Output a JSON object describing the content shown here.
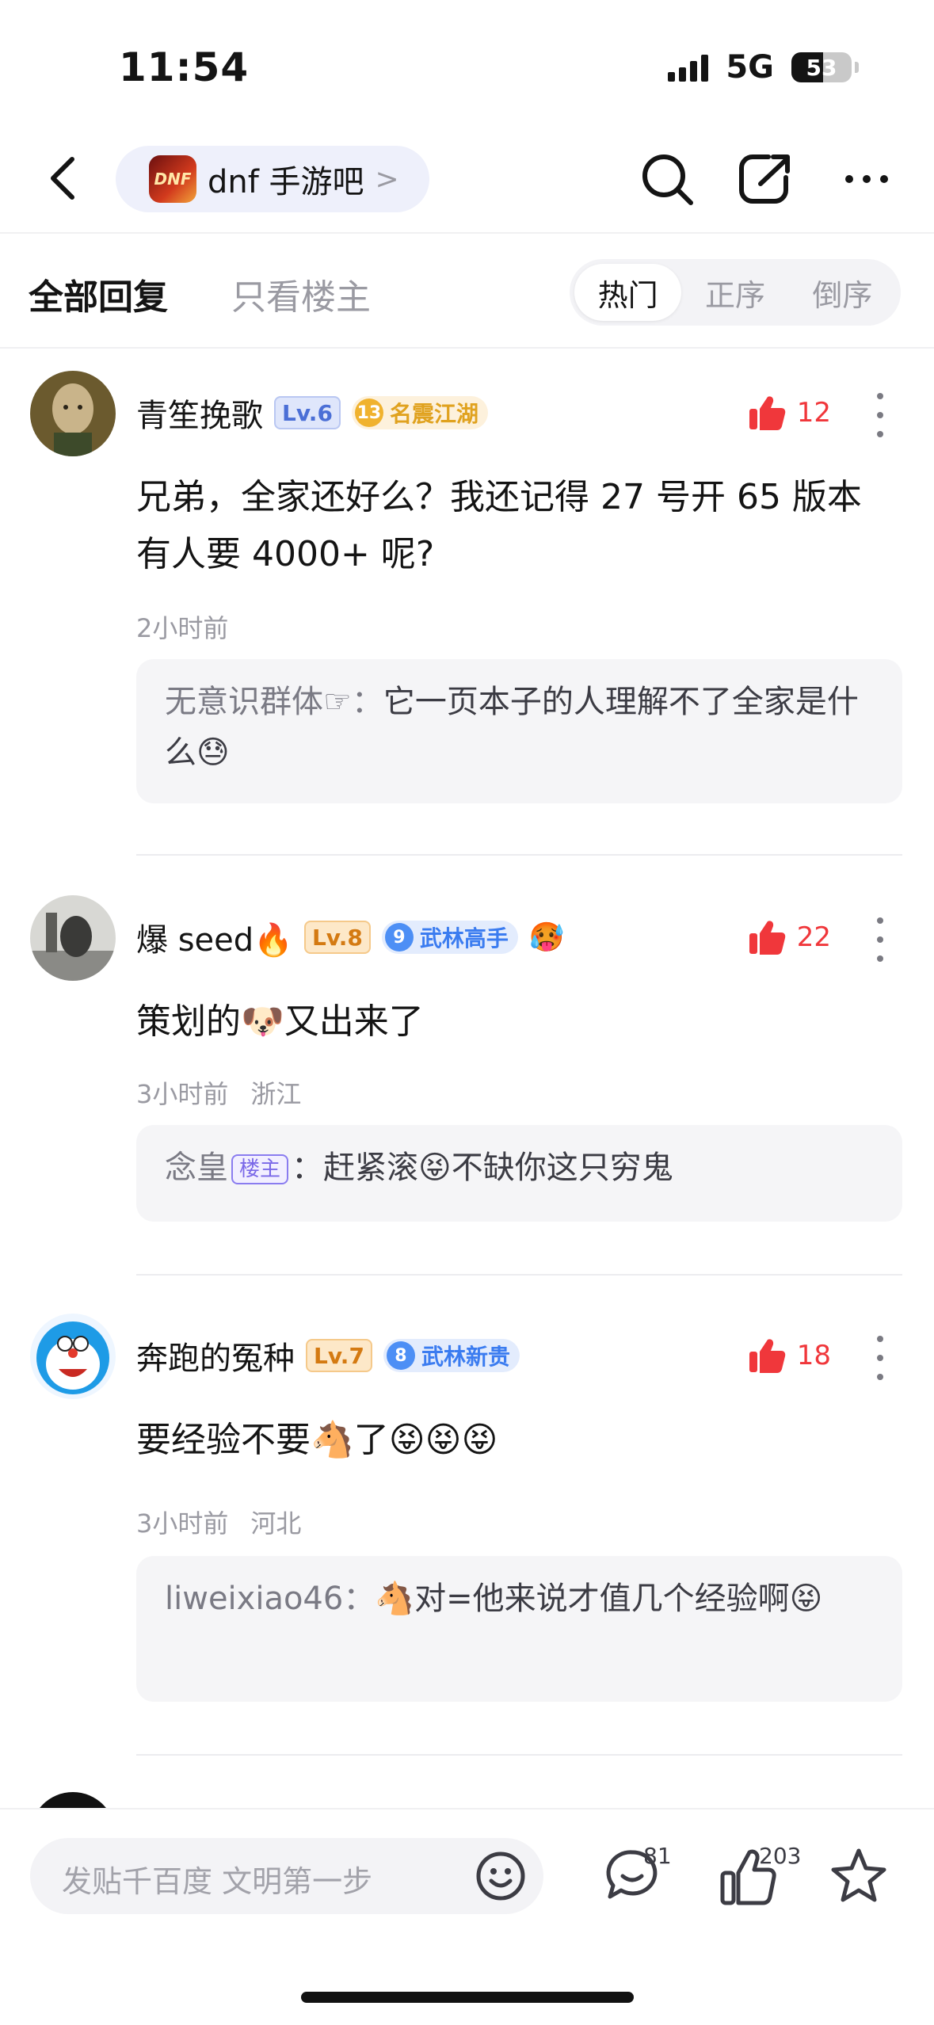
{
  "status_bar": {
    "time": "11:54",
    "network": "5G",
    "battery": "53"
  },
  "nav": {
    "forum_name": "dnf 手游吧",
    "forum_chevron": ">"
  },
  "filter": {
    "all_replies": "全部回复",
    "owner_only": "只看楼主",
    "sort_options": [
      "热门",
      "正序",
      "倒序"
    ],
    "sort_selected": "热门"
  },
  "comments": [
    {
      "name": "青笙挽歌",
      "level": "Lv.6",
      "title_rank": "13",
      "title": "名震江湖",
      "likes": "12",
      "body": "兄弟，全家还好么？我还记得 27 号开 65 版本有人要 4000+ 呢?",
      "time": "2小时前",
      "location": "",
      "reply": {
        "author": "无意识群体☞：",
        "text": "它一页本子的人理解不了全家是什么😓"
      }
    },
    {
      "name": "爆 seed🔥",
      "level": "Lv.8",
      "title_rank": "9",
      "title": "武林高手",
      "extra_badge": "🥵",
      "likes": "22",
      "body": "策划的🐶又出来了",
      "time": "3小时前",
      "location": "浙江",
      "reply": {
        "author": "念皇",
        "owner_tag": "楼主",
        "sep": "：",
        "text": "赶紧滚😝不缺你这只穷鬼"
      }
    },
    {
      "name": "奔跑的冤种",
      "level": "Lv.7",
      "title_rank": "8",
      "title": "武林新贵",
      "likes": "18",
      "body": "要经验不要🐴了😝😝😝",
      "time": "3小时前",
      "location": "河北",
      "reply": {
        "author": "liweixiao46：",
        "text": "🐴对=他来说才值几个经验啊😝"
      }
    }
  ],
  "bottom": {
    "compose_placeholder": "发贴千百度 文明第一步",
    "comment_count": "81",
    "like_count": "203"
  }
}
